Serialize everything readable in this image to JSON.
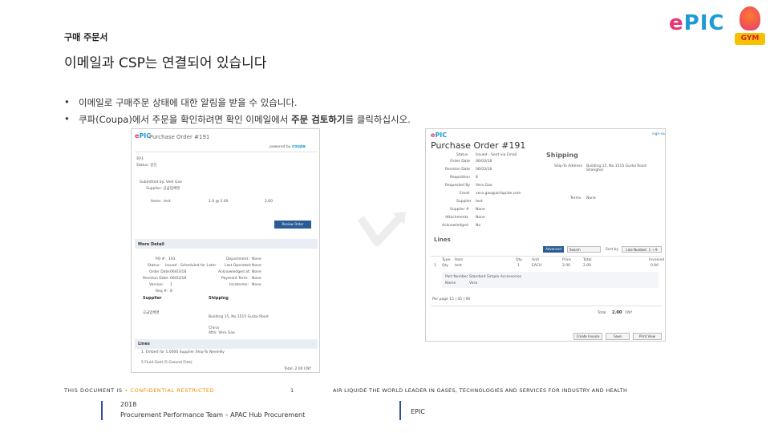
{
  "header": {
    "breadcrumb": "구매 주문서",
    "title": "이메일과 CSP는 연결되어 있습니다",
    "logo_text_e": "e",
    "logo_text_rest": "PIC",
    "gym_badge": "GYM"
  },
  "bullets": [
    {
      "text_before": "이메일로 구매주문 상태에 대한 알림을 받을 수 있습니다.",
      "text_bold": "",
      "text_after": ""
    },
    {
      "text_before": "쿠파(Coupa)에서 주문을 확인하려면 확인 이메일에서 ",
      "text_bold": "주문 검토하기",
      "text_after": "를 클릭하십시오."
    }
  ],
  "email_shot": {
    "title": "Purchase Order #191",
    "powered": "powered by",
    "brand": "coupa",
    "line1": "회사:",
    "line2": "Status: 승인",
    "submitted": "Submitted by: Veel Gao",
    "supplier": "Supplier: 공급업체명",
    "items_label": "Items",
    "item_name": "test",
    "item_qty": "1.0 @ 2.00",
    "item_total": "2.00",
    "button": "Review Order",
    "more_detail": "More Detail",
    "po_label": "PO #:",
    "po_value": "191",
    "status_label": "Status:",
    "status_value": "Issued - Scheduled for Later",
    "order_date_label": "Order Date:",
    "order_date": "06/03/18",
    "revision_label": "Revision Date:",
    "revision": "06/03/18",
    "version_label": "Version:",
    "version": "1",
    "req_label": "Req #:",
    "req": "8",
    "dept_label": "Department:",
    "dept": "None",
    "lastop_label": "Last Operated:",
    "lastop": "None",
    "ack_label": "Acknowledged at:",
    "ack": "None",
    "payterm_label": "Payment Term:",
    "payterm": "None",
    "incoterm_label": "Incoterms:",
    "incoterm": "None",
    "supplier_label": "Supplier",
    "shipping_label": "Shipping",
    "supplier_name": "공급업체명",
    "ship_addr": "Building 15, No.1515 Gudai Road",
    "ship_city": "China",
    "ship_attn": "Attn: Vera Gao",
    "lines_label": "Lines",
    "lines_row": "1. Embed for 1.0000   Supplier   Ship-To   Need-By",
    "lines_row2": "5 Fluid Gold (5 Ground Free)",
    "total": "Total: 2.00 CNY"
  },
  "coupa_shot": {
    "title": "Purchase Order #191",
    "sign": "sign-out",
    "status_label": "Status",
    "status_value": "Issued - Sent via Email",
    "order_date_label": "Order Date",
    "order_date": "06/03/18",
    "revision_label": "Revision Date",
    "revision": "06/03/18",
    "req_label": "Requisition",
    "req": "8",
    "req_by_label": "Requested By",
    "req_by": "Vera Gao",
    "email_label": "Email",
    "email": "vera.gao@airliquide.com",
    "supplier_label": "Supplier",
    "supplier": "test",
    "supp_num_label": "Supplier #",
    "supp_num": "None",
    "po_trans_label": "Attachments",
    "po_trans": "None",
    "ack_label": "Acknowledged",
    "ack": "No",
    "shipping": "Shipping",
    "ship_to_label": "Ship-To Address",
    "ship_to": "Building 15, No.1515 Gudai Road Shanghai",
    "terms_label": "Terms",
    "terms": "None",
    "lines": "Lines",
    "advanced": "Advanced",
    "search": "Search",
    "sort_label": "Sort by",
    "sort_value": "Line Number: 1 → 9",
    "col_type": "Type",
    "col_item": "Item",
    "col_qty": "Qty",
    "col_unit": "Unit",
    "col_price": "Price",
    "col_total": "Total",
    "col_received": "Invoiced",
    "row_num": "1",
    "row_type": "Qty",
    "row_item": "test",
    "row_qty": "1",
    "row_unit": "EACH",
    "row_price": "2.00",
    "row_total": "2.00",
    "row_received": "0.00",
    "part_label": "Part Number",
    "part_value": "Standard Simple Accessories",
    "name_label": "Name",
    "name_value": "Vera",
    "pager": "Per page 15 | 45 | 90",
    "total_label": "Total",
    "total_value": "2.00",
    "total_cur": "CNY",
    "btn1": "Create Invoice",
    "btn2": "Save",
    "btn3": "Print View"
  },
  "footer": {
    "doc_prefix": "THIS DOCUMENT IS ",
    "doc_conf": "• CONFIDENTIAL RESTRICTED",
    "page_num": "1",
    "tagline": "AIR LIQUIDE THE WORLD LEADER IN GASES, TECHNOLOGIES AND SERVICES FOR INDUSTRY AND HEALTH",
    "year": "2018",
    "team": "Procurement Performance Team – APAC Hub Procurement",
    "right": "EPIC"
  }
}
